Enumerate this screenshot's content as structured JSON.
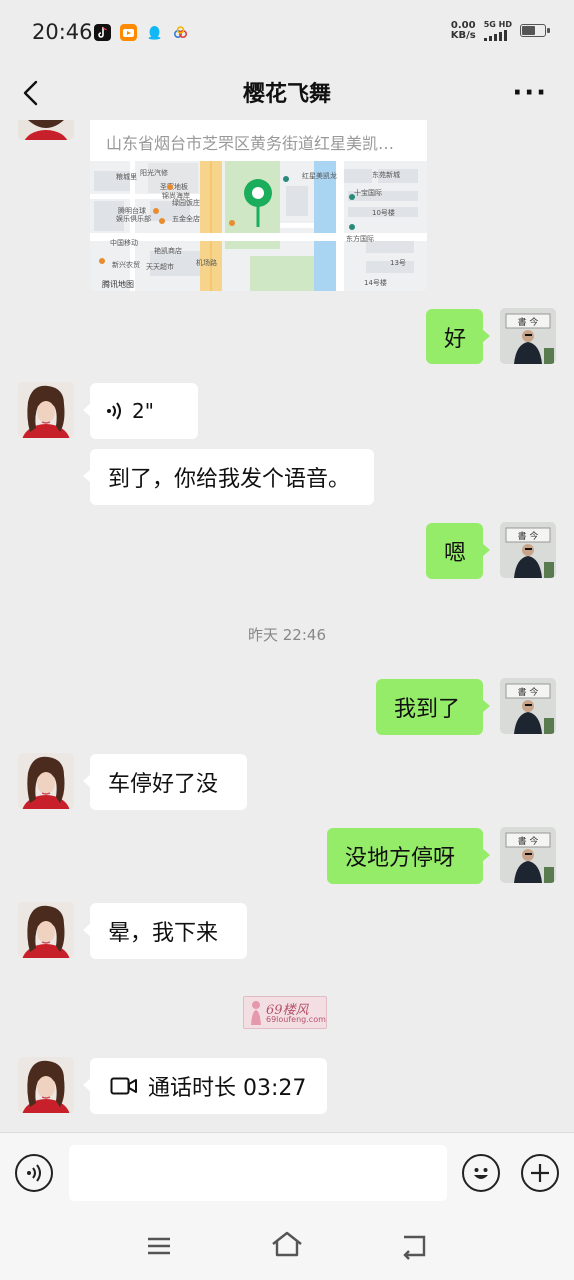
{
  "status_bar": {
    "time": "20:46",
    "net_speed_value": "0.00",
    "net_speed_unit": "KB/s",
    "network_type": "5G HD",
    "app_icons": [
      "tiktok-icon",
      "video-app-icon",
      "qq-icon",
      "cloud-app-icon"
    ]
  },
  "chat": {
    "title": "樱花飞舞",
    "more": "···"
  },
  "location": {
    "address": "山东省烟台市芝罘区黄务街道红星美凯…",
    "map_provider": "腾讯地图",
    "map_labels": {
      "l1": "粮城里",
      "l2": "阳光汽修",
      "l3": "圣家地板",
      "l4": "锦尚海岸",
      "l5": "腾明台球",
      "l6": "娱乐俱乐部",
      "l7": "绿园饭庄",
      "l8": "五金全店",
      "l9": "中国移动",
      "l10": "新兴农贸",
      "l11": "天天超市",
      "l12": "艳凯商店",
      "l13": "东方国际",
      "l14": "十宝国际",
      "l15": "机场路",
      "l16": "红星美凯龙",
      "l17": "东苑新城",
      "l18": "10号楼",
      "l19": "13号",
      "l20": "14号楼"
    }
  },
  "messages": [
    {
      "id": "m1",
      "dir": "out",
      "text": "好"
    },
    {
      "id": "m2",
      "dir": "in",
      "type": "voice",
      "duration": "2\""
    },
    {
      "id": "m3",
      "dir": "in",
      "text": "到了，你给我发个语音。"
    },
    {
      "id": "m4",
      "dir": "out",
      "text": "嗯"
    },
    {
      "id": "m5",
      "dir": "out",
      "text": "我到了"
    },
    {
      "id": "m6",
      "dir": "in",
      "text": "车停好了没"
    },
    {
      "id": "m7",
      "dir": "out",
      "text": "没地方停呀"
    },
    {
      "id": "m8",
      "dir": "in",
      "text": "晕，我下来"
    },
    {
      "id": "m9",
      "dir": "in",
      "type": "video-call",
      "text": "通话时长 03:27"
    }
  ],
  "timestamp": "昨天 22:46",
  "watermark": {
    "big": "69楼风",
    "small": "69loufeng.com"
  },
  "colors": {
    "background": "#ededed",
    "bubble_out": "#95ec69",
    "bubble_in": "#ffffff",
    "map_pin": "#1aad5b"
  }
}
